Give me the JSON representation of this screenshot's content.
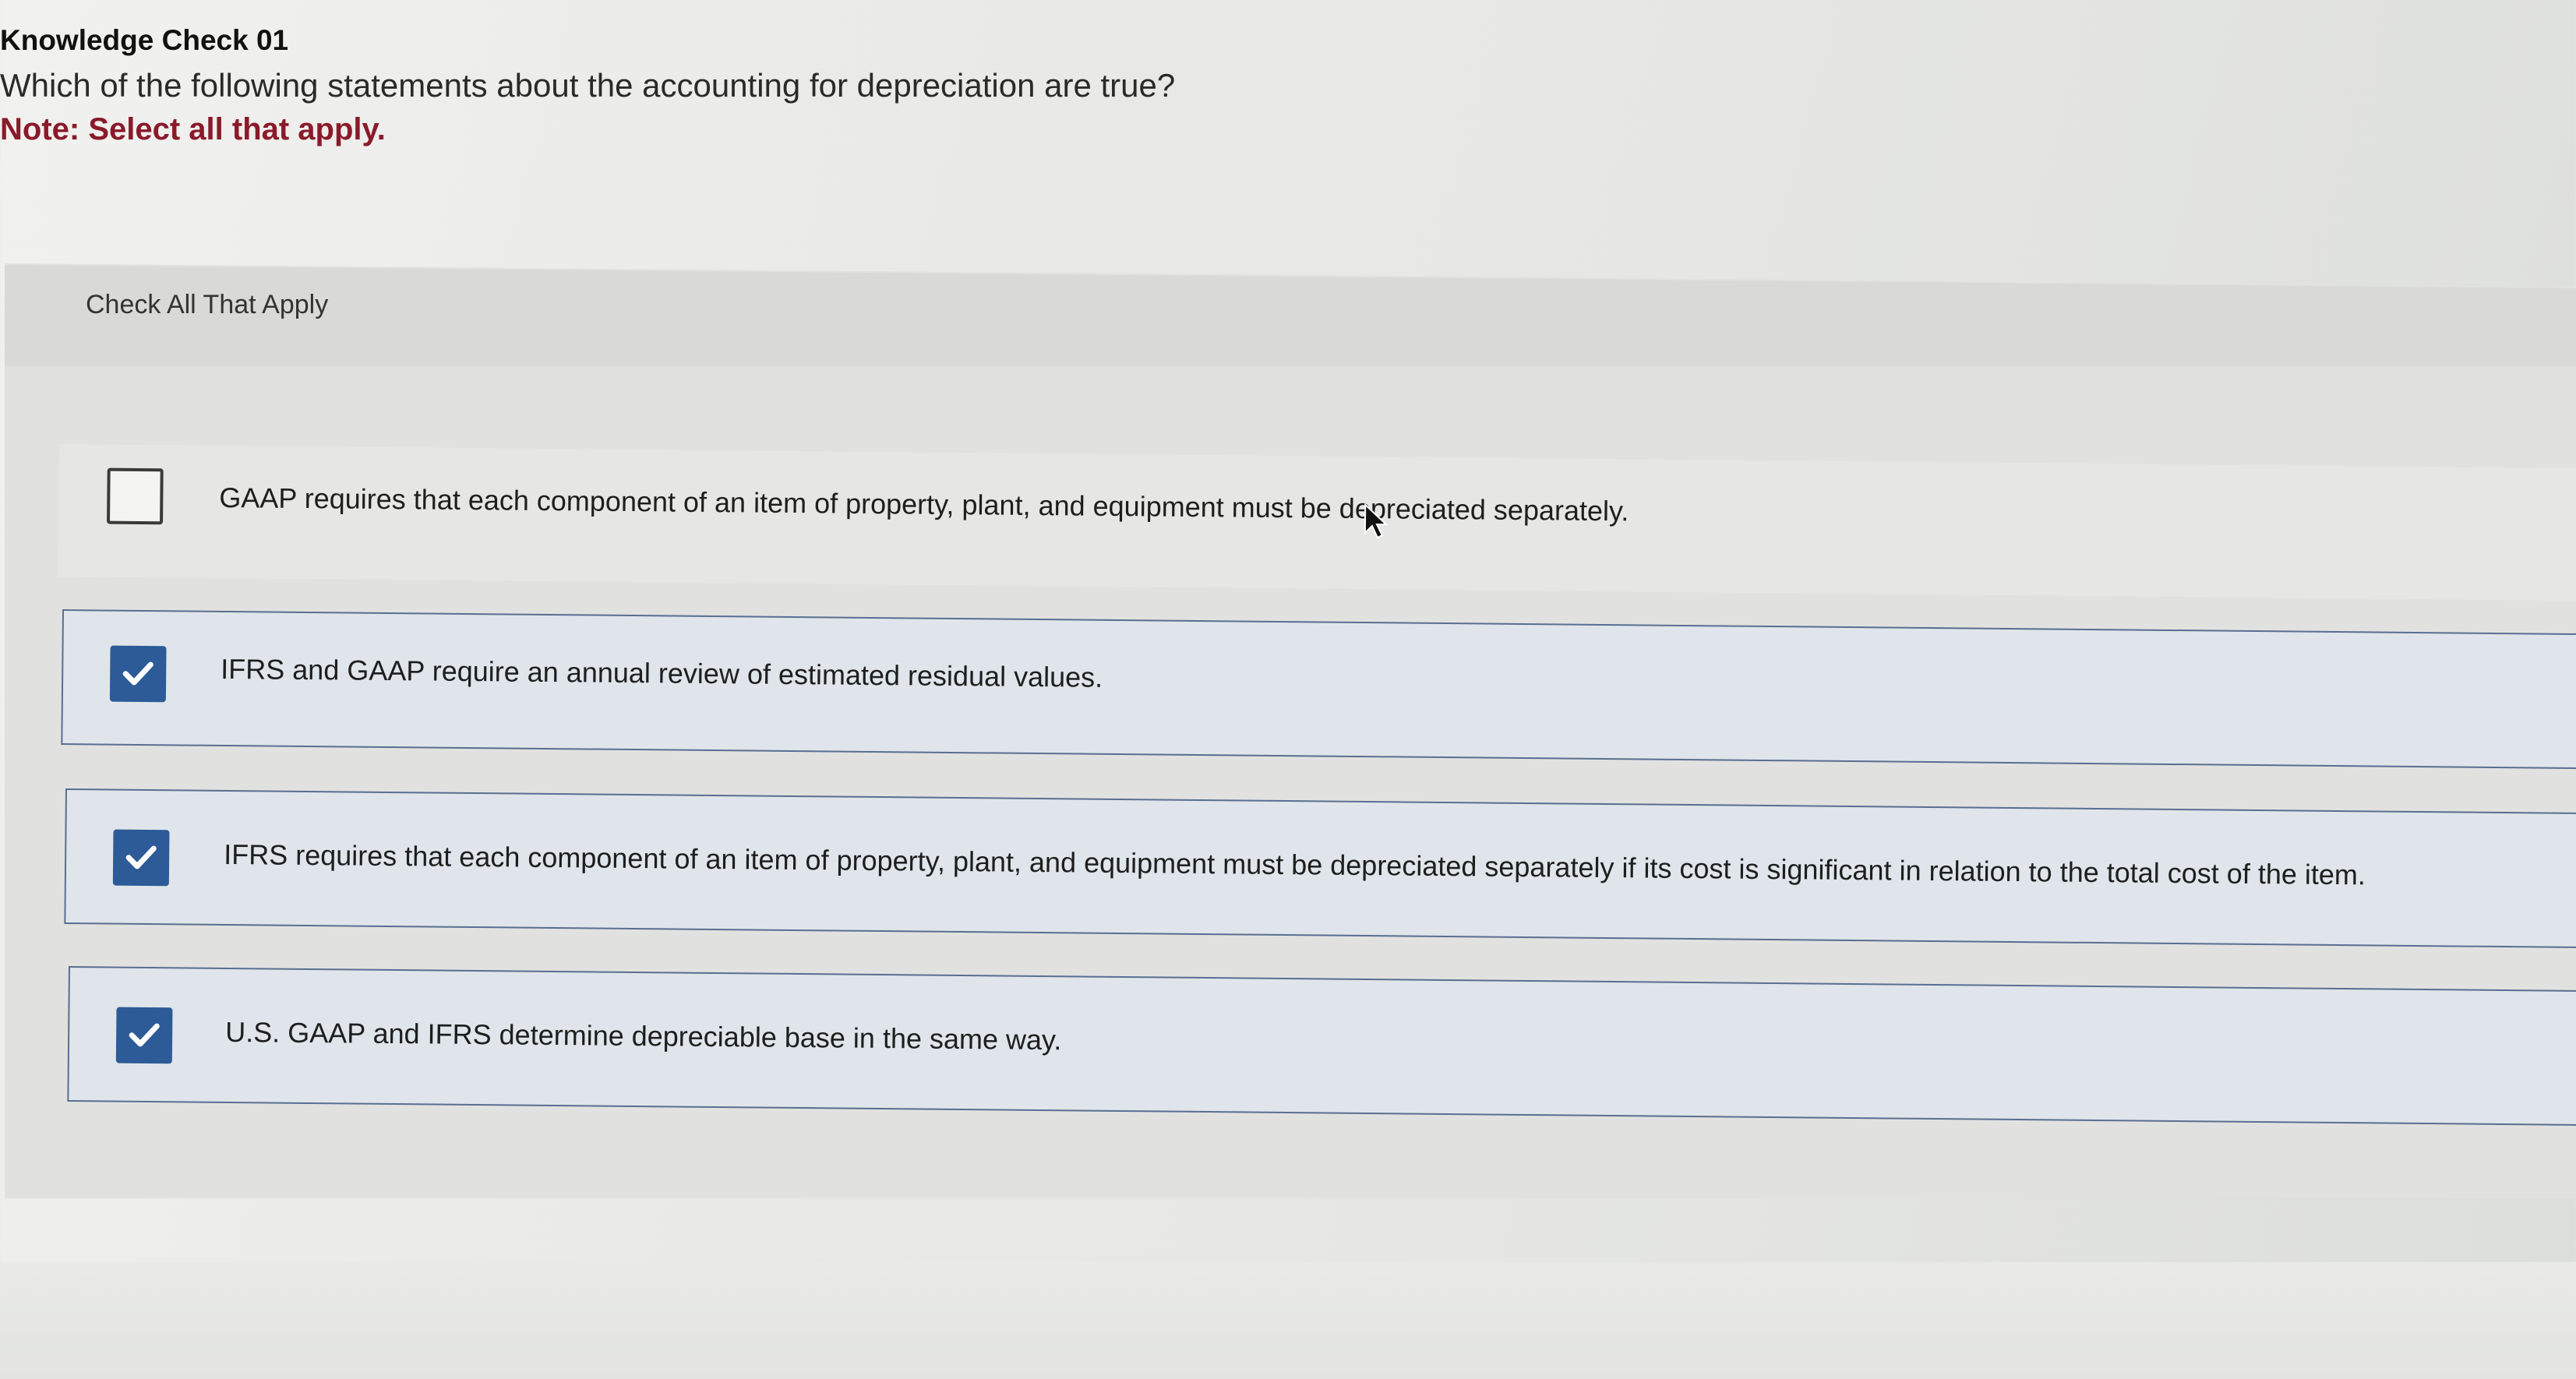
{
  "question": {
    "title": "Knowledge Check 01",
    "text": "Which of the following statements about the accounting for depreciation are true?",
    "note": "Note: Select all that apply."
  },
  "panel": {
    "header_label": "Check All That Apply"
  },
  "options": [
    {
      "label": "GAAP requires that each component of an item of property, plant, and equipment must be depreciated separately.",
      "checked": false
    },
    {
      "label": "IFRS and GAAP require an annual review of estimated residual values.",
      "checked": true
    },
    {
      "label": "IFRS requires that each component of an item of property, plant, and equipment must be depreciated separately if its cost is significant in relation to the total cost of the item.",
      "checked": true
    },
    {
      "label": "U.S. GAAP and IFRS determine depreciable base in the same way.",
      "checked": true
    }
  ],
  "colors": {
    "note": "#8a1a2a",
    "checkbox_checked": "#2c5b97",
    "selected_border": "#5a6e90",
    "selected_bg": "#dfe5ea"
  },
  "icons": {
    "checkmark": "check-icon",
    "cursor": "mouse-pointer-icon"
  }
}
